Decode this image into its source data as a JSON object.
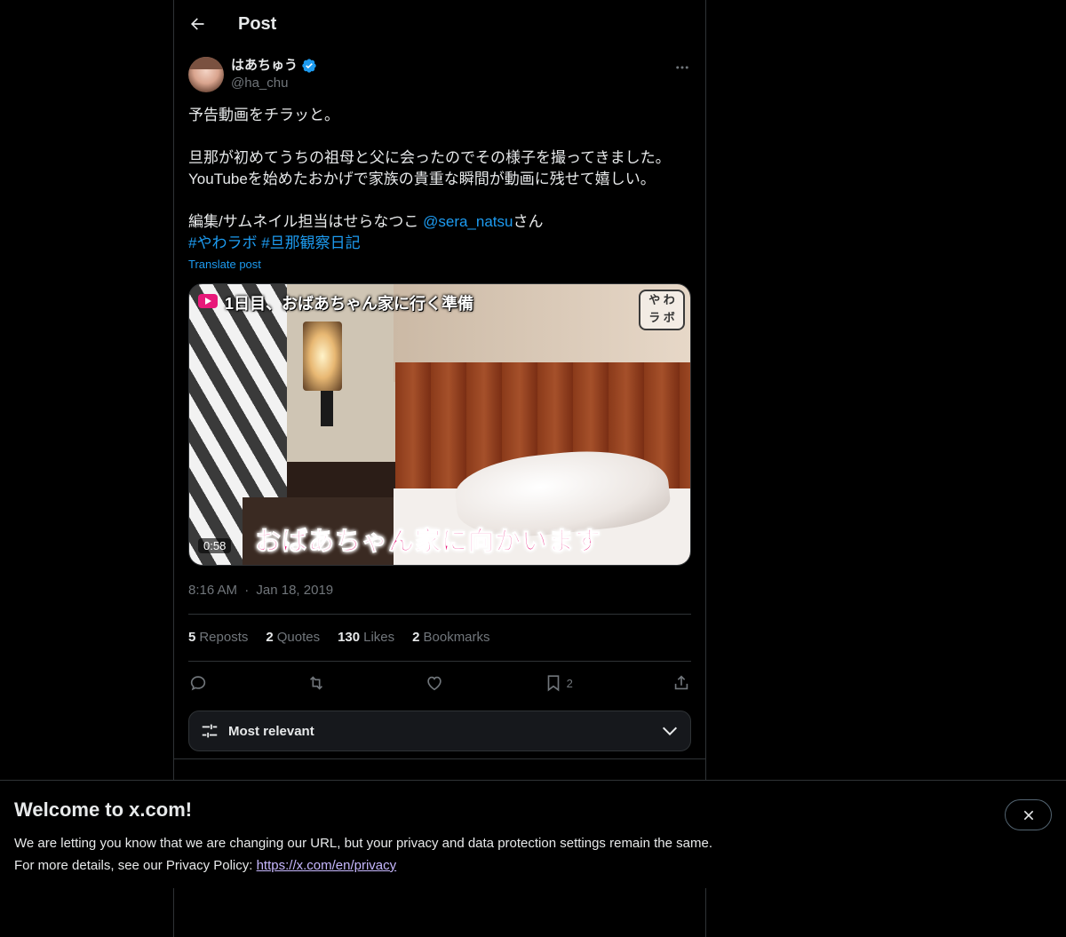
{
  "header": {
    "title": "Post",
    "back_icon": "back-arrow-icon"
  },
  "post": {
    "author": {
      "display_name": "はあちゅう",
      "handle": "@ha_chu",
      "verified": true
    },
    "text_line1": "予告動画をチラッと。",
    "text_line3": "旦那が初めてうちの祖母と父に会ったのでその様子を撮ってきました。",
    "text_line4": "YouTubeを始めたおかげで家族の貴重な瞬間が動画に残せて嬉しい。",
    "text_line6_pre": "編集/サムネイル担当はせらなつこ ",
    "mention": "@sera_natsu",
    "text_line6_post": "さん",
    "hashtag1": "#やわラボ",
    "hashtag2": "#旦那観察日記",
    "translate_label": "Translate post",
    "media": {
      "caption_top": "1日目、おばあちゃん家に行く準備",
      "caption_bottom": "おばあちゃん家に向かいます",
      "logo_text_line1": "や わ",
      "logo_text_line2": "ラ ボ",
      "duration": "0:58"
    },
    "time": "8:16 AM",
    "date_sep": "·",
    "date": "Jan 18, 2019",
    "stats": {
      "reposts_count": "5",
      "reposts_label": "Reposts",
      "quotes_count": "2",
      "quotes_label": "Quotes",
      "likes_count": "130",
      "likes_label": "Likes",
      "bookmarks_count": "2",
      "bookmarks_label": "Bookmarks"
    },
    "actions": {
      "bookmark_count": "2"
    }
  },
  "sort": {
    "label": "Most relevant"
  },
  "banner": {
    "title": "Welcome to x.com!",
    "line1": "We are letting you know that we are changing our URL, but your privacy and data protection settings remain the same.",
    "line2_pre": "For more details, see our Privacy Policy: ",
    "link": "https://x.com/en/privacy"
  },
  "colors": {
    "accent": "#1d9bf0",
    "background": "#000000",
    "muted": "#71767b",
    "border": "#2f3336",
    "caption_pink": "#e8197a"
  }
}
